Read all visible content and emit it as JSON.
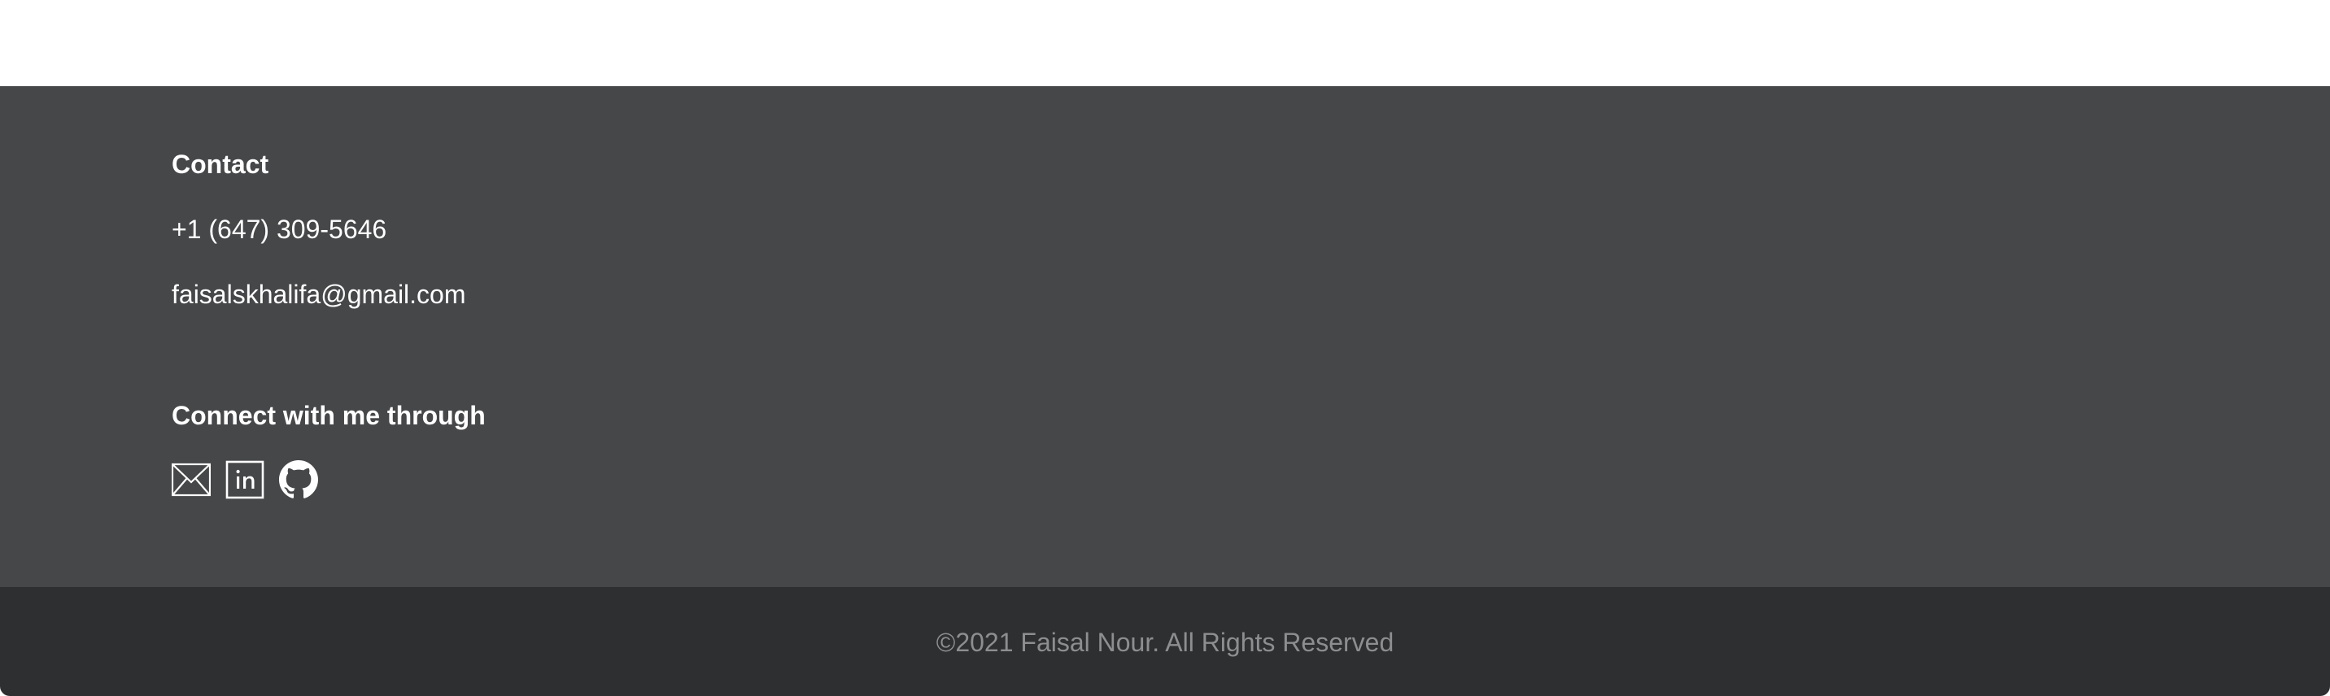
{
  "footer": {
    "contact": {
      "heading": "Contact",
      "phone": "+1 (647) 309-5646",
      "email": "faisalskhalifa@gmail.com"
    },
    "connect": {
      "heading": "Connect with me through",
      "icons": [
        "mail-icon",
        "linkedin-icon",
        "github-icon"
      ]
    },
    "copyright": "©2021 Faisal Nour. All Rights Reserved"
  },
  "colors": {
    "footer_main_bg": "#464749",
    "footer_bottom_bg": "#2e2f31",
    "text_primary": "#ffffff",
    "text_muted": "#8d8e90"
  }
}
